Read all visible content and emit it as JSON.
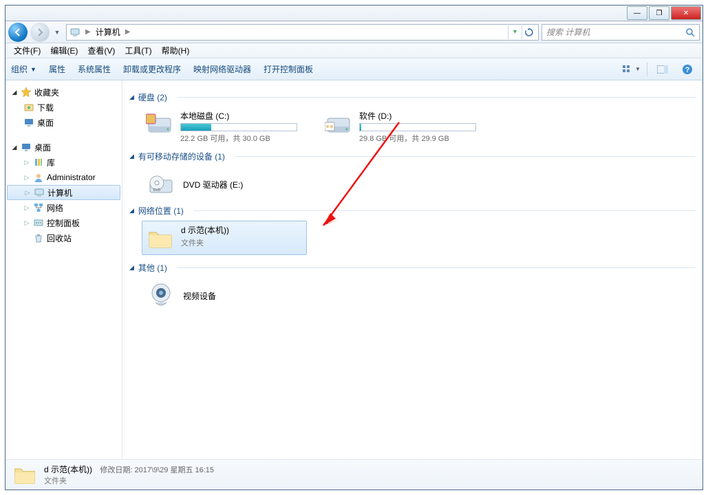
{
  "titlebar": {
    "min_glyph": "—",
    "max_glyph": "❐",
    "close_glyph": "✕"
  },
  "nav": {
    "address_parts": [
      "计算机"
    ],
    "search_placeholder": "搜索 计算机"
  },
  "menu": {
    "file": "文件(F)",
    "edit": "编辑(E)",
    "view": "查看(V)",
    "tools": "工具(T)",
    "help": "帮助(H)"
  },
  "toolbar": {
    "organize": "组织",
    "properties": "属性",
    "sysprops": "系统属性",
    "uninstall": "卸载或更改程序",
    "mapdrive": "映射网络驱动器",
    "controlpanel": "打开控制面板"
  },
  "sidebar": {
    "favorites": "收藏夹",
    "downloads": "下载",
    "desktop_item": "桌面",
    "desktop_root": "桌面",
    "libraries": "库",
    "admin": "Administrator",
    "computer": "计算机",
    "network": "网络",
    "controlpanel": "控制面板",
    "recycle": "回收站"
  },
  "content": {
    "group_hdd": "硬盘 (2)",
    "group_removable": "有可移动存储的设备 (1)",
    "group_netloc": "网络位置 (1)",
    "group_other": "其他 (1)",
    "drive_c": {
      "label": "本地磁盘 (C:)",
      "free_text": "22.2 GB 可用，共 30.0 GB",
      "fill_pct": 26
    },
    "drive_d": {
      "label": "软件 (D:)",
      "free_text": "29.8 GB 可用，共 29.9 GB",
      "fill_pct": 1
    },
    "dvd": "DVD 驱动器 (E:)",
    "netfolder": {
      "name": "d 示范(本机))",
      "type": "文件夹"
    },
    "videodev": "视频设备"
  },
  "status": {
    "name": "d 示范(本机))",
    "meta_label": "修改日期:",
    "meta_value": "2017\\9\\29 星期五 16:15",
    "type": "文件夹"
  }
}
